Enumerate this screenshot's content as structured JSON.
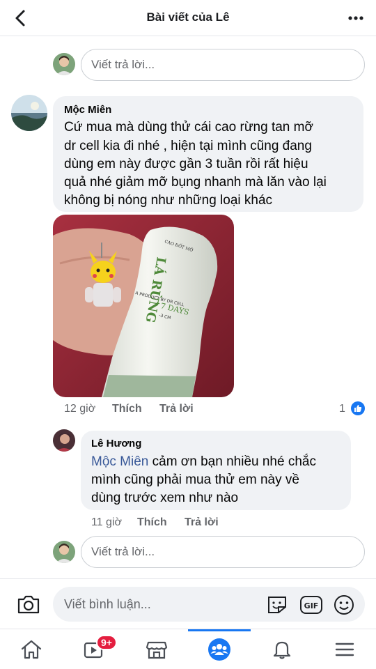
{
  "header": {
    "title": "Bài viết của Lê"
  },
  "reply_box": {
    "placeholder": "Viết trả lời..."
  },
  "comment1": {
    "author": "Mộc Miên",
    "lines": [
      "Cứ mua mà dùng thử cái  cao rừng tan mỡ",
      "dr cell kia đi nhé , hiện tại mình cũng đang",
      "dùng em này được gần 3 tuần rồi rất hiệu",
      "quả nhé giảm mỡ bụng nhanh mà lăn vào lại",
      "không bị nóng như những loại khác"
    ],
    "time": "12 giờ",
    "like_label": "Thích",
    "reply_label": "Trả lời",
    "reaction_count": "1",
    "photo": {
      "brand_small": "CAO ĐỐT MỠ",
      "brand_big": "LÁ RỪNG",
      "product_line": "A PRODUCT BY DR CELL",
      "days": "7 DAYS",
      "size": "-3 CM"
    }
  },
  "comment2": {
    "author": "Lê Hương",
    "mention": "Mộc Miên",
    "line1_rest": " cảm ơn bạn nhiều nhé chắc",
    "line2": "mình cũng phải mua thử em này về",
    "line3": "dùng trước xem như nào",
    "time": "11 giờ",
    "like_label": "Thích",
    "reply_label": "Trả lời"
  },
  "composer": {
    "placeholder": "Viết bình luận..."
  },
  "nav": {
    "watch_badge": "9+"
  },
  "colors": {
    "accent": "#1877f2",
    "badge": "#e41e3f",
    "bubble": "#f0f2f5"
  }
}
